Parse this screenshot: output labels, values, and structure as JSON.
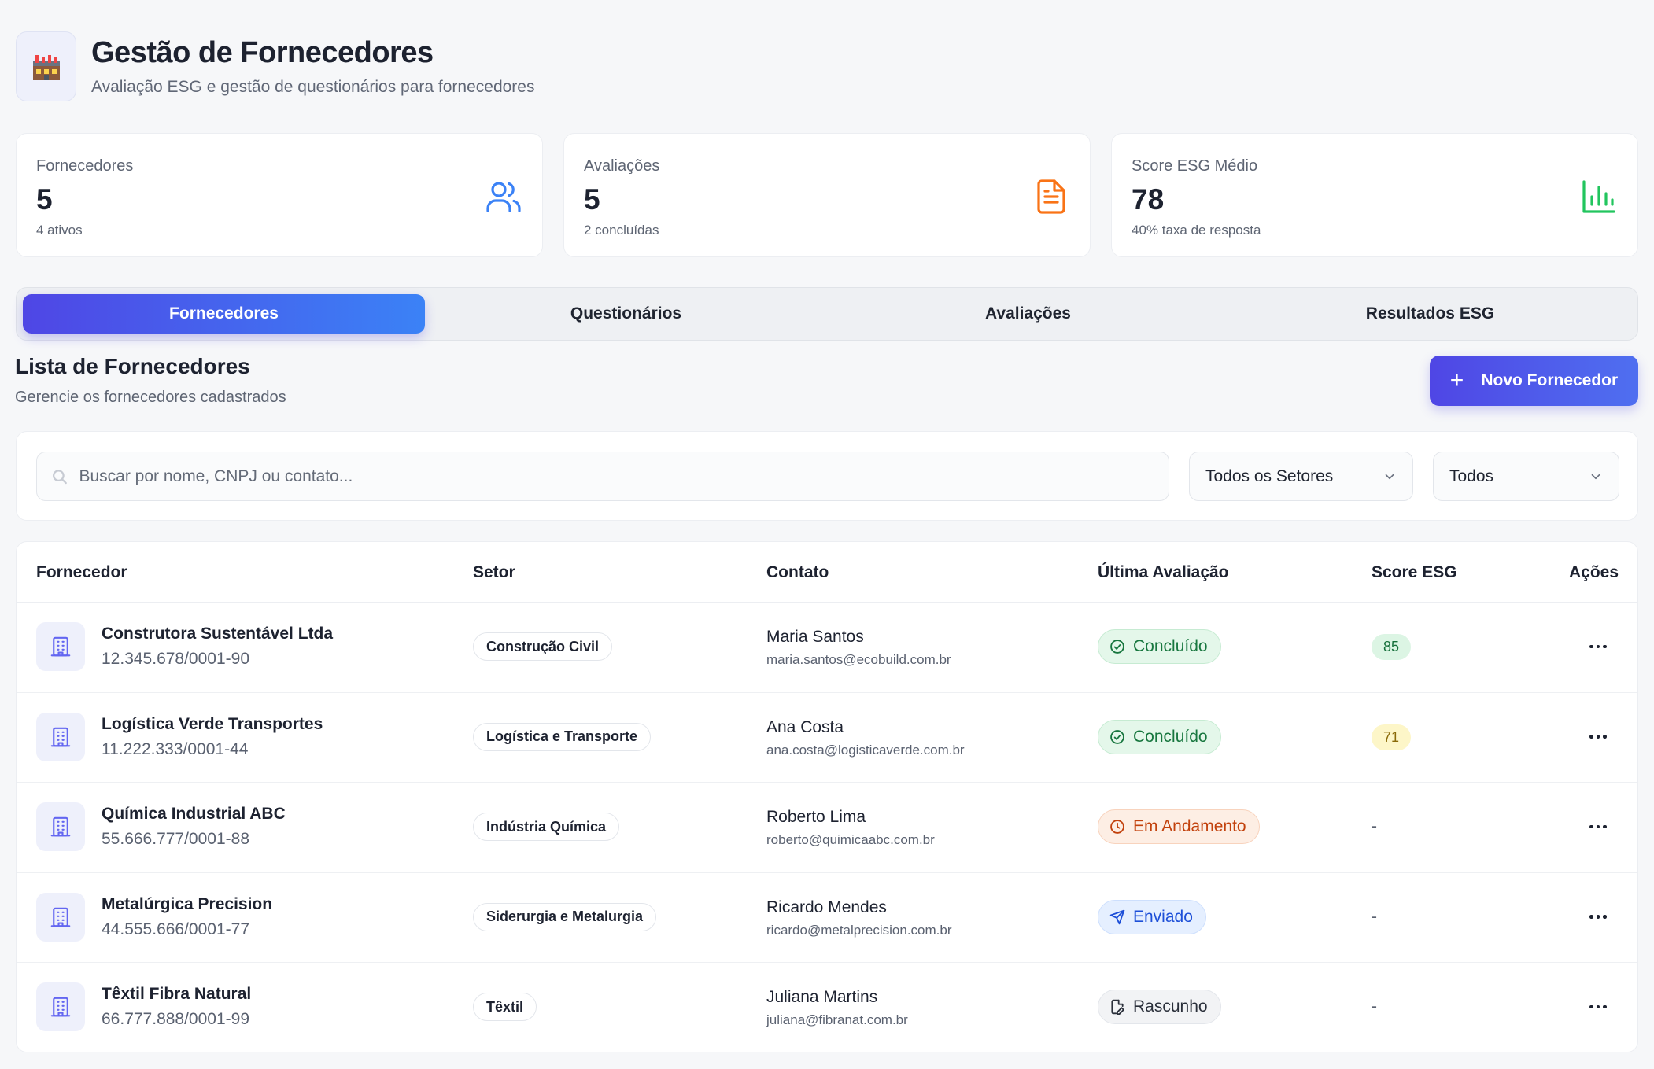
{
  "header": {
    "title": "Gestão de Fornecedores",
    "subtitle": "Avaliação ESG e gestão de questionários para fornecedores",
    "logo_icon": "factory-icon"
  },
  "stats": [
    {
      "label": "Fornecedores",
      "value": "5",
      "sub": "4 ativos",
      "icon": "users-icon",
      "color": "#3b82f6"
    },
    {
      "label": "Avaliações",
      "value": "5",
      "sub": "2 concluídas",
      "icon": "document-icon",
      "color": "#f97316"
    },
    {
      "label": "Score ESG Médio",
      "value": "78",
      "sub": "40% taxa de resposta",
      "icon": "bar-chart-icon",
      "color": "#22c55e"
    }
  ],
  "tabs": [
    {
      "label": "Fornecedores",
      "active": true
    },
    {
      "label": "Questionários",
      "active": false
    },
    {
      "label": "Avaliações",
      "active": false
    },
    {
      "label": "Resultados ESG",
      "active": false
    }
  ],
  "section": {
    "title": "Lista de Fornecedores",
    "subtitle": "Gerencie os fornecedores cadastrados",
    "new_button": "Novo Fornecedor"
  },
  "filters": {
    "search_placeholder": "Buscar por nome, CNPJ ou contato...",
    "search_value": "",
    "sector_selected": "Todos os Setores",
    "status_selected": "Todos"
  },
  "table": {
    "columns": [
      "Fornecedor",
      "Setor",
      "Contato",
      "Última Avaliação",
      "Score ESG",
      "Ações"
    ],
    "rows": [
      {
        "name": "Construtora Sustentável Ltda",
        "cnpj": "12.345.678/0001-90",
        "sector": "Construção Civil",
        "contact": "Maria Santos",
        "email": "maria.santos@ecobuild.com.br",
        "status": "Concluído",
        "status_type": "green",
        "status_icon": "check-circle-icon",
        "score": "85",
        "score_type": "green"
      },
      {
        "name": "Logística Verde Transportes",
        "cnpj": "11.222.333/0001-44",
        "sector": "Logística e Transporte",
        "contact": "Ana Costa",
        "email": "ana.costa@logisticaverde.com.br",
        "status": "Concluído",
        "status_type": "green",
        "status_icon": "check-circle-icon",
        "score": "71",
        "score_type": "yellow"
      },
      {
        "name": "Química Industrial ABC",
        "cnpj": "55.666.777/0001-88",
        "sector": "Indústria Química",
        "contact": "Roberto Lima",
        "email": "roberto@quimicaabc.com.br",
        "status": "Em Andamento",
        "status_type": "orange",
        "status_icon": "clock-icon",
        "score": "-",
        "score_type": "none"
      },
      {
        "name": "Metalúrgica Precision",
        "cnpj": "44.555.666/0001-77",
        "sector": "Siderurgia e Metalurgia",
        "contact": "Ricardo Mendes",
        "email": "ricardo@metalprecision.com.br",
        "status": "Enviado",
        "status_type": "blue",
        "status_icon": "send-icon",
        "score": "-",
        "score_type": "none"
      },
      {
        "name": "Têxtil Fibra Natural",
        "cnpj": "66.777.888/0001-99",
        "sector": "Têxtil",
        "contact": "Juliana Martins",
        "email": "juliana@fibranat.com.br",
        "status": "Rascunho",
        "status_type": "gray",
        "status_icon": "file-edit-icon",
        "score": "-",
        "score_type": "none"
      }
    ]
  }
}
